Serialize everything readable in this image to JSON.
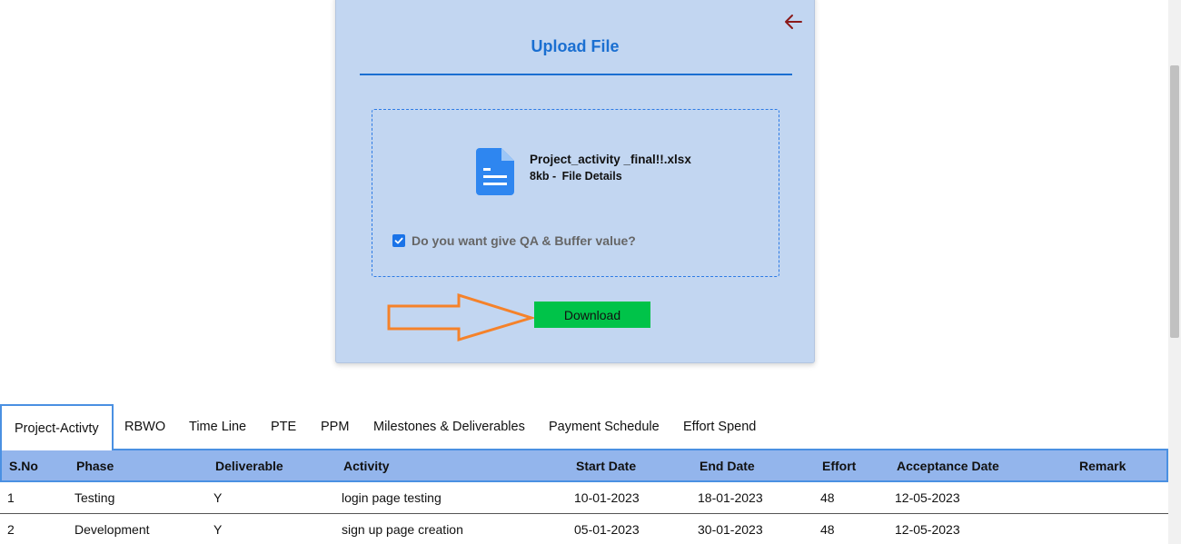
{
  "upload": {
    "title": "Upload File",
    "file_name": "Project_activity _final!!.xlsx",
    "file_size": "8kb -",
    "file_details": "File Details",
    "qa_label": "Do you want give QA & Buffer value?",
    "qa_checked": true,
    "download_label": "Download",
    "icons": {
      "back": "arrow-left-icon",
      "file": "document-icon",
      "checkbox": "checkmark-icon",
      "pointer": "orange-arrow-right-annotation"
    }
  },
  "tabs": [
    {
      "label": "Project-Activty",
      "active": true
    },
    {
      "label": "RBWO",
      "active": false
    },
    {
      "label": "Time Line",
      "active": false
    },
    {
      "label": "PTE",
      "active": false
    },
    {
      "label": "PPM",
      "active": false
    },
    {
      "label": "Milestones & Deliverables",
      "active": false
    },
    {
      "label": "Payment Schedule",
      "active": false
    },
    {
      "label": "Effort Spend",
      "active": false
    }
  ],
  "table": {
    "columns": [
      "S.No",
      "Phase",
      "Deliverable",
      "Activity",
      "Start Date",
      "End Date",
      "Effort",
      "Acceptance Date",
      "Remark"
    ],
    "rows": [
      [
        "1",
        "Testing",
        "Y",
        "login page testing",
        "10-01-2023",
        "18-01-2023",
        "48",
        "12-05-2023",
        ""
      ],
      [
        "2",
        "Development",
        "Y",
        "sign up page creation",
        "05-01-2023",
        "30-01-2023",
        "48",
        "12-05-2023",
        ""
      ]
    ]
  },
  "colors": {
    "card_bg": "#c2d6f1",
    "accent_blue": "#1a6fd1",
    "download_green": "#00c349",
    "annotation_orange": "#f5822a",
    "back_arrow": "#8b1a1a",
    "table_header_bg": "#93b5ec"
  }
}
